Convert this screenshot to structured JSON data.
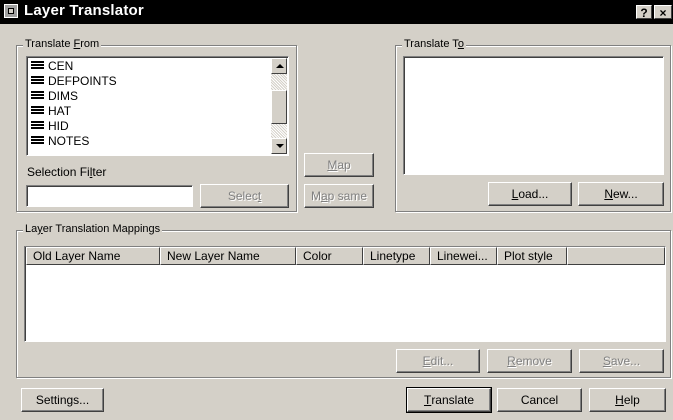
{
  "window": {
    "title": "Layer Translator",
    "help_glyph": "?",
    "close_glyph": "×"
  },
  "translate_from": {
    "group_label_pre": "Translate ",
    "group_label_key": "F",
    "group_label_post": "rom",
    "layers": [
      "CEN",
      "DEFPOINTS",
      "DIMS",
      "HAT",
      "HID",
      "NOTES"
    ],
    "selection_filter_label_pre": "Selection Fi",
    "selection_filter_label_key": "l",
    "selection_filter_label_post": "ter",
    "selection_filter_value": "",
    "select_button_pre": "Selec",
    "select_button_key": "t",
    "select_button_post": ""
  },
  "middle": {
    "map_button_pre": "",
    "map_button_key": "M",
    "map_button_post": "ap",
    "map_same_button_pre": "M",
    "map_same_button_key": "a",
    "map_same_button_post": "p same"
  },
  "translate_to": {
    "group_label_pre": "Translate T",
    "group_label_key": "o",
    "group_label_post": "",
    "load_button_pre": "",
    "load_button_key": "L",
    "load_button_post": "oad...",
    "new_button_pre": "",
    "new_button_key": "N",
    "new_button_post": "ew..."
  },
  "mappings": {
    "group_label_pre": "La",
    "group_label_key": "y",
    "group_label_post": "er Translation Mappings",
    "columns": [
      "Old Layer Name",
      "New Layer Name",
      "Color",
      "Linetype",
      "Linewei...",
      "Plot style"
    ],
    "rows": [],
    "edit_button_pre": "",
    "edit_button_key": "E",
    "edit_button_post": "dit...",
    "remove_button_pre": "",
    "remove_button_key": "R",
    "remove_button_post": "emove",
    "save_button_pre": "",
    "save_button_key": "S",
    "save_button_post": "ave..."
  },
  "footer": {
    "settings_button": "Settings...",
    "translate_button_pre": "",
    "translate_button_key": "T",
    "translate_button_post": "ranslate",
    "cancel_button": "Cancel",
    "help_button_pre": "",
    "help_button_key": "H",
    "help_button_post": "elp"
  },
  "colors": {
    "face": "#d4d0c8",
    "titlebar": "#000000",
    "disabled_text": "#808080"
  }
}
